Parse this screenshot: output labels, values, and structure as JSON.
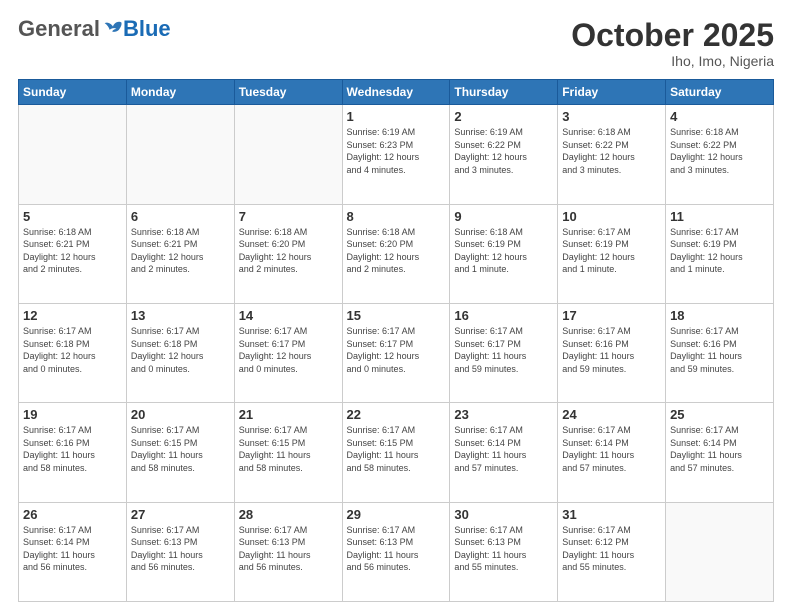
{
  "logo": {
    "general": "General",
    "blue": "Blue"
  },
  "header": {
    "month": "October 2025",
    "location": "Iho, Imo, Nigeria"
  },
  "weekdays": [
    "Sunday",
    "Monday",
    "Tuesday",
    "Wednesday",
    "Thursday",
    "Friday",
    "Saturday"
  ],
  "weeks": [
    [
      {
        "day": "",
        "info": ""
      },
      {
        "day": "",
        "info": ""
      },
      {
        "day": "",
        "info": ""
      },
      {
        "day": "1",
        "info": "Sunrise: 6:19 AM\nSunset: 6:23 PM\nDaylight: 12 hours\nand 4 minutes."
      },
      {
        "day": "2",
        "info": "Sunrise: 6:19 AM\nSunset: 6:22 PM\nDaylight: 12 hours\nand 3 minutes."
      },
      {
        "day": "3",
        "info": "Sunrise: 6:18 AM\nSunset: 6:22 PM\nDaylight: 12 hours\nand 3 minutes."
      },
      {
        "day": "4",
        "info": "Sunrise: 6:18 AM\nSunset: 6:22 PM\nDaylight: 12 hours\nand 3 minutes."
      }
    ],
    [
      {
        "day": "5",
        "info": "Sunrise: 6:18 AM\nSunset: 6:21 PM\nDaylight: 12 hours\nand 2 minutes."
      },
      {
        "day": "6",
        "info": "Sunrise: 6:18 AM\nSunset: 6:21 PM\nDaylight: 12 hours\nand 2 minutes."
      },
      {
        "day": "7",
        "info": "Sunrise: 6:18 AM\nSunset: 6:20 PM\nDaylight: 12 hours\nand 2 minutes."
      },
      {
        "day": "8",
        "info": "Sunrise: 6:18 AM\nSunset: 6:20 PM\nDaylight: 12 hours\nand 2 minutes."
      },
      {
        "day": "9",
        "info": "Sunrise: 6:18 AM\nSunset: 6:19 PM\nDaylight: 12 hours\nand 1 minute."
      },
      {
        "day": "10",
        "info": "Sunrise: 6:17 AM\nSunset: 6:19 PM\nDaylight: 12 hours\nand 1 minute."
      },
      {
        "day": "11",
        "info": "Sunrise: 6:17 AM\nSunset: 6:19 PM\nDaylight: 12 hours\nand 1 minute."
      }
    ],
    [
      {
        "day": "12",
        "info": "Sunrise: 6:17 AM\nSunset: 6:18 PM\nDaylight: 12 hours\nand 0 minutes."
      },
      {
        "day": "13",
        "info": "Sunrise: 6:17 AM\nSunset: 6:18 PM\nDaylight: 12 hours\nand 0 minutes."
      },
      {
        "day": "14",
        "info": "Sunrise: 6:17 AM\nSunset: 6:17 PM\nDaylight: 12 hours\nand 0 minutes."
      },
      {
        "day": "15",
        "info": "Sunrise: 6:17 AM\nSunset: 6:17 PM\nDaylight: 12 hours\nand 0 minutes."
      },
      {
        "day": "16",
        "info": "Sunrise: 6:17 AM\nSunset: 6:17 PM\nDaylight: 11 hours\nand 59 minutes."
      },
      {
        "day": "17",
        "info": "Sunrise: 6:17 AM\nSunset: 6:16 PM\nDaylight: 11 hours\nand 59 minutes."
      },
      {
        "day": "18",
        "info": "Sunrise: 6:17 AM\nSunset: 6:16 PM\nDaylight: 11 hours\nand 59 minutes."
      }
    ],
    [
      {
        "day": "19",
        "info": "Sunrise: 6:17 AM\nSunset: 6:16 PM\nDaylight: 11 hours\nand 58 minutes."
      },
      {
        "day": "20",
        "info": "Sunrise: 6:17 AM\nSunset: 6:15 PM\nDaylight: 11 hours\nand 58 minutes."
      },
      {
        "day": "21",
        "info": "Sunrise: 6:17 AM\nSunset: 6:15 PM\nDaylight: 11 hours\nand 58 minutes."
      },
      {
        "day": "22",
        "info": "Sunrise: 6:17 AM\nSunset: 6:15 PM\nDaylight: 11 hours\nand 58 minutes."
      },
      {
        "day": "23",
        "info": "Sunrise: 6:17 AM\nSunset: 6:14 PM\nDaylight: 11 hours\nand 57 minutes."
      },
      {
        "day": "24",
        "info": "Sunrise: 6:17 AM\nSunset: 6:14 PM\nDaylight: 11 hours\nand 57 minutes."
      },
      {
        "day": "25",
        "info": "Sunrise: 6:17 AM\nSunset: 6:14 PM\nDaylight: 11 hours\nand 57 minutes."
      }
    ],
    [
      {
        "day": "26",
        "info": "Sunrise: 6:17 AM\nSunset: 6:14 PM\nDaylight: 11 hours\nand 56 minutes."
      },
      {
        "day": "27",
        "info": "Sunrise: 6:17 AM\nSunset: 6:13 PM\nDaylight: 11 hours\nand 56 minutes."
      },
      {
        "day": "28",
        "info": "Sunrise: 6:17 AM\nSunset: 6:13 PM\nDaylight: 11 hours\nand 56 minutes."
      },
      {
        "day": "29",
        "info": "Sunrise: 6:17 AM\nSunset: 6:13 PM\nDaylight: 11 hours\nand 56 minutes."
      },
      {
        "day": "30",
        "info": "Sunrise: 6:17 AM\nSunset: 6:13 PM\nDaylight: 11 hours\nand 55 minutes."
      },
      {
        "day": "31",
        "info": "Sunrise: 6:17 AM\nSunset: 6:12 PM\nDaylight: 11 hours\nand 55 minutes."
      },
      {
        "day": "",
        "info": ""
      }
    ]
  ]
}
